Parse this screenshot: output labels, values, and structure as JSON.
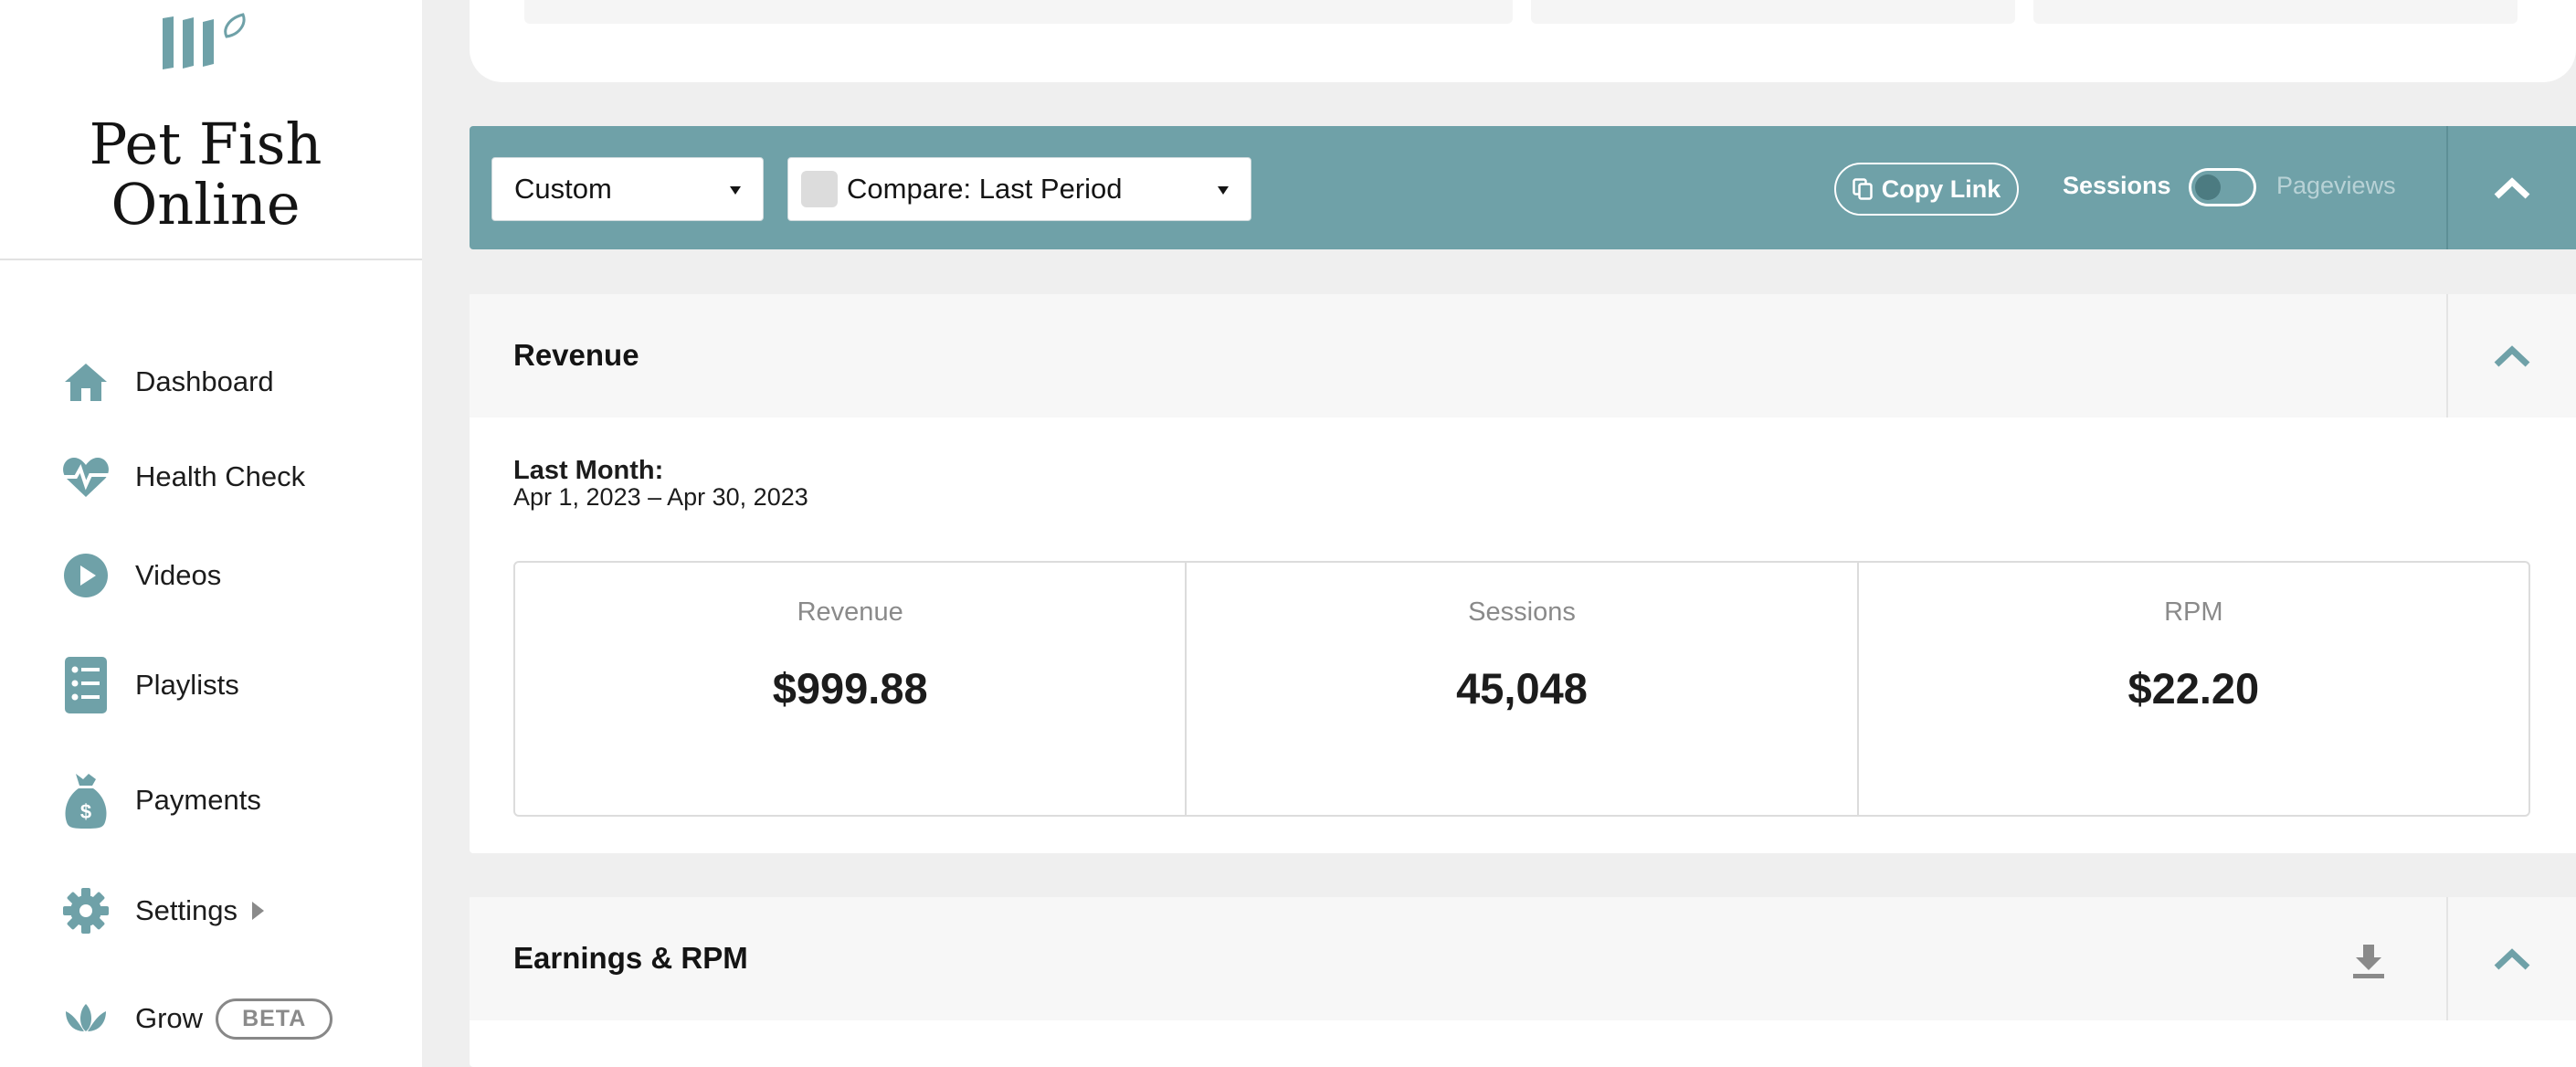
{
  "brand": {
    "name": "Pet Fish Online",
    "logo_icon": "mv-logo-icon",
    "accent": "#6fa1a8"
  },
  "sidebar": {
    "items": [
      {
        "label": "Dashboard",
        "icon": "home-icon"
      },
      {
        "label": "Health Check",
        "icon": "heartbeat-icon"
      },
      {
        "label": "Videos",
        "icon": "play-circle-icon"
      },
      {
        "label": "Playlists",
        "icon": "checklist-icon"
      },
      {
        "label": "Payments",
        "icon": "money-bag-icon"
      },
      {
        "label": "Settings",
        "icon": "gear-icon"
      },
      {
        "label": "Grow",
        "icon": "lotus-icon",
        "badge": "BETA"
      }
    ]
  },
  "filters": {
    "date_range": "Custom",
    "compare": "Compare: Last Period",
    "copy_link": "Copy Link",
    "toggle_left": "Sessions",
    "toggle_right": "Pageviews"
  },
  "revenue": {
    "title": "Revenue",
    "period_label": "Last Month:",
    "period_range": "Apr 1, 2023 – Apr 30, 2023",
    "stats": [
      {
        "label": "Revenue",
        "value": "$999.88"
      },
      {
        "label": "Sessions",
        "value": "45,048"
      },
      {
        "label": "RPM",
        "value": "$22.20"
      }
    ]
  },
  "earnings": {
    "title": "Earnings & RPM"
  }
}
